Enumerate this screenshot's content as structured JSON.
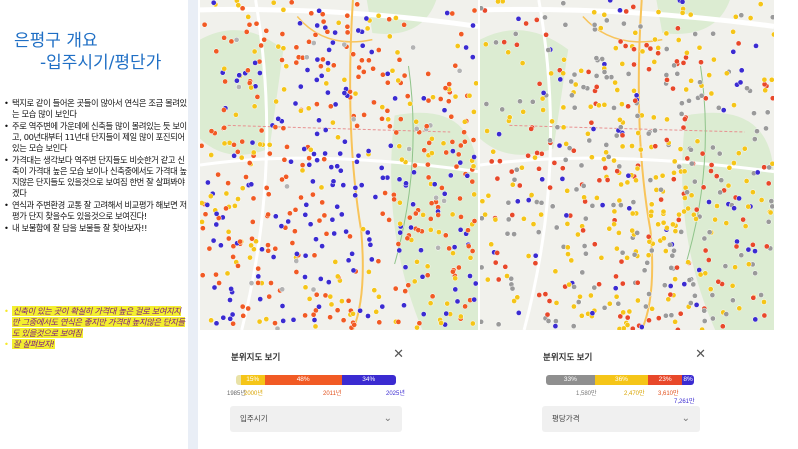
{
  "slide": {
    "title_line1": "은평구  개요",
    "title_line2": "-입주시기/평단가",
    "bullets": [
      "택지로 같이 들어온 곳들이 많아서 연식은 조금 몰려있는 모습 많이 보인다",
      "주로 역주변에 가운데에 신축들 많이 몰려있는 듯 보이고, 00년대부터 11년대 단지들이 제일 많이 포진되어있는 모습 보인다",
      "가격대는 생각보다 역주변 단지들도 비슷한거 같고 신축이 가격대 높은 모습 보이나 신축중에서도 가격대 높지않은 단지들도 있을것으로 보여짐 한번 잘 살펴봐야겠다",
      "연식과 주변환경 교통 잘 고려해서 비교평가 해보면 저평가 단지 찾을수도 있을것으로 보여진다!",
      "내 보물함에 잘 담을 보물들 잘 찾아보자!!"
    ],
    "highlights": [
      "신축이 있는 곳이 확실히 가격대 높은 걸로 보여지지만 그중에서도 연식은 좋지만 가격대 높지않은 단지들도 있을것으로 보여짐",
      "잘 살펴보자!"
    ]
  },
  "legend_age": {
    "title": "분위지도 보기",
    "segments": [
      {
        "label": "",
        "pct": 3,
        "color": "#e9e2a7"
      },
      {
        "label": "15%",
        "pct": 15,
        "color": "#f5c518"
      },
      {
        "label": "48%",
        "pct": 48,
        "color": "#f15a24"
      },
      {
        "label": "34%",
        "pct": 34,
        "color": "#3b2bd1"
      }
    ],
    "ticks": [
      {
        "text": "1985년",
        "color": "#666"
      },
      {
        "text": "2000년",
        "color": "#d9a400"
      },
      {
        "text": "2011년",
        "color": "#e2501b"
      },
      {
        "text": "2025년",
        "color": "#3b2bd1"
      }
    ],
    "select_label": "입주시기"
  },
  "legend_price": {
    "title": "분위지도 보기",
    "segments": [
      {
        "label": "33%",
        "pct": 33,
        "color": "#8f8f8f"
      },
      {
        "label": "36%",
        "pct": 36,
        "color": "#f5c518"
      },
      {
        "label": "23%",
        "pct": 23,
        "color": "#e8482a"
      },
      {
        "label": "8%",
        "pct": 8,
        "color": "#3b2bd1"
      }
    ],
    "ticks": [
      {
        "text": "1,580만",
        "color": "#777"
      },
      {
        "text": "2,470만",
        "color": "#d9a400"
      },
      {
        "text": "3,610만",
        "color": "#e2501b"
      },
      {
        "text": "7,261만",
        "color": "#3b2bd1"
      }
    ],
    "select_label": "평당가격"
  },
  "colors": {
    "title_blue": "#1f6fc5",
    "highlight_yellow": "#f3ee2f",
    "highlight_text": "#7a1b7f"
  }
}
